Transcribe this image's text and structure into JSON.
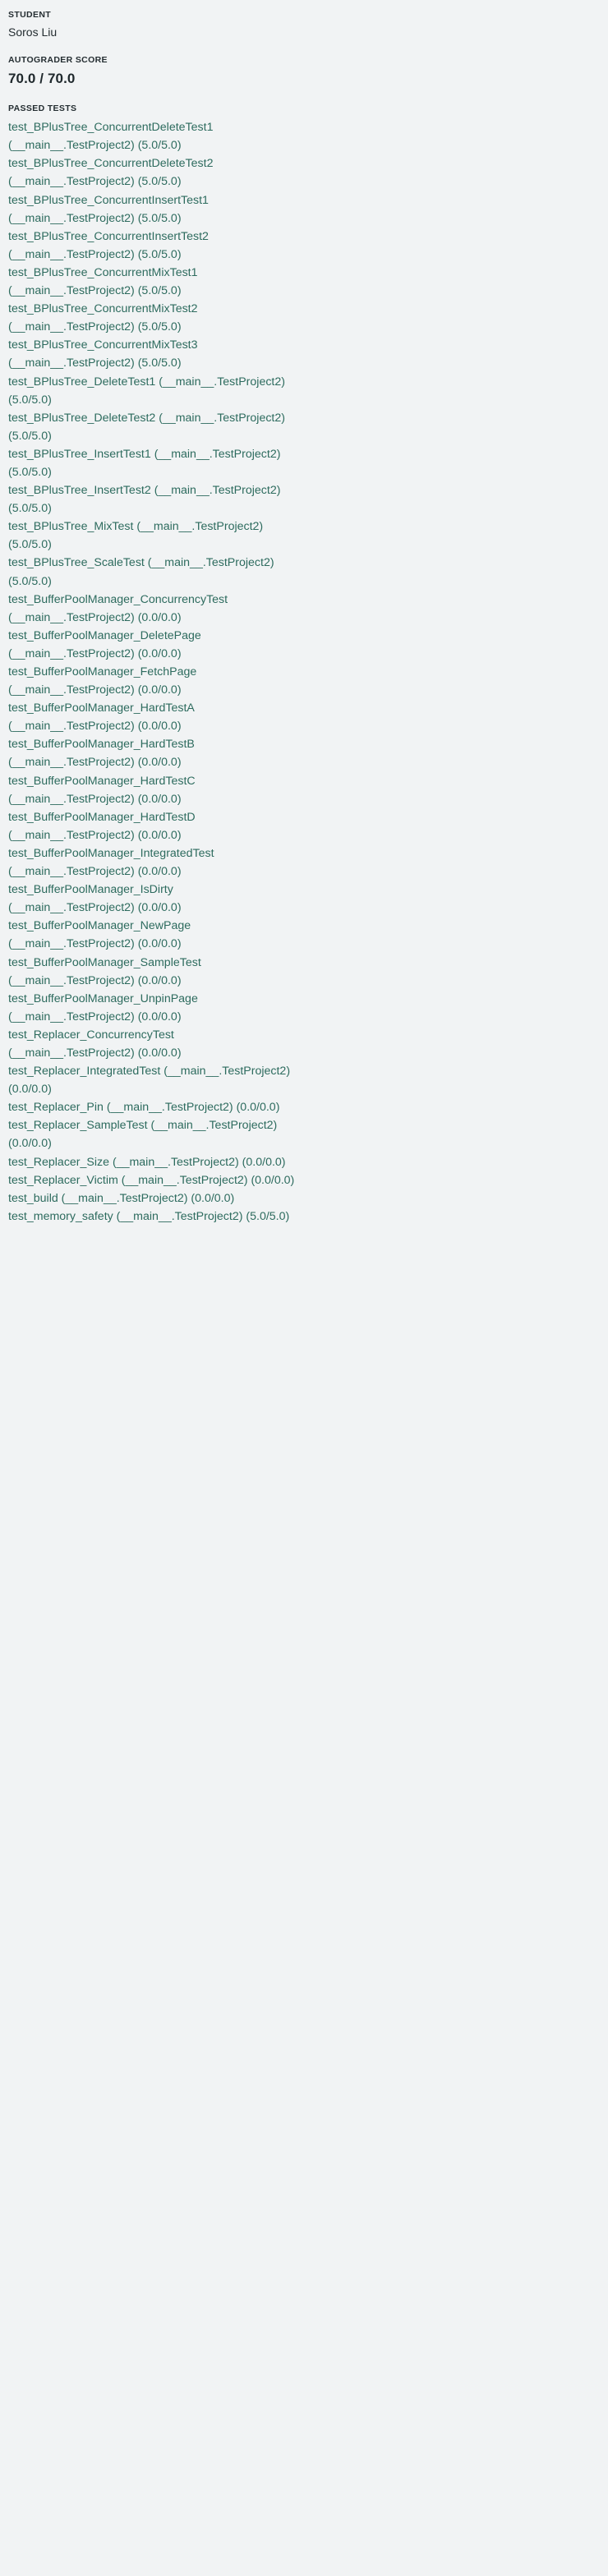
{
  "student": {
    "label": "STUDENT",
    "name": "Soros Liu"
  },
  "autograder": {
    "label": "AUTOGRADER SCORE",
    "score": "70.0 / 70.0"
  },
  "passed_tests": {
    "label": "PASSED TESTS",
    "items": [
      "test_BPlusTree_ConcurrentDeleteTest1 (__main__.TestProject2) (5.0/5.0)",
      "test_BPlusTree_ConcurrentDeleteTest2 (__main__.TestProject2) (5.0/5.0)",
      "test_BPlusTree_ConcurrentInsertTest1 (__main__.TestProject2) (5.0/5.0)",
      "test_BPlusTree_ConcurrentInsertTest2 (__main__.TestProject2) (5.0/5.0)",
      "test_BPlusTree_ConcurrentMixTest1 (__main__.TestProject2) (5.0/5.0)",
      "test_BPlusTree_ConcurrentMixTest2 (__main__.TestProject2) (5.0/5.0)",
      "test_BPlusTree_ConcurrentMixTest3 (__main__.TestProject2) (5.0/5.0)",
      "test_BPlusTree_DeleteTest1 (__main__.TestProject2) (5.0/5.0)",
      "test_BPlusTree_DeleteTest2 (__main__.TestProject2) (5.0/5.0)",
      "test_BPlusTree_InsertTest1 (__main__.TestProject2) (5.0/5.0)",
      "test_BPlusTree_InsertTest2 (__main__.TestProject2) (5.0/5.0)",
      "test_BPlusTree_MixTest (__main__.TestProject2) (5.0/5.0)",
      "test_BPlusTree_ScaleTest (__main__.TestProject2) (5.0/5.0)",
      "test_BufferPoolManager_ConcurrencyTest (__main__.TestProject2) (0.0/0.0)",
      "test_BufferPoolManager_DeletePage (__main__.TestProject2) (0.0/0.0)",
      "test_BufferPoolManager_FetchPage (__main__.TestProject2) (0.0/0.0)",
      "test_BufferPoolManager_HardTestA (__main__.TestProject2) (0.0/0.0)",
      "test_BufferPoolManager_HardTestB (__main__.TestProject2) (0.0/0.0)",
      "test_BufferPoolManager_HardTestC (__main__.TestProject2) (0.0/0.0)",
      "test_BufferPoolManager_HardTestD (__main__.TestProject2) (0.0/0.0)",
      "test_BufferPoolManager_IntegratedTest (__main__.TestProject2) (0.0/0.0)",
      "test_BufferPoolManager_IsDirty (__main__.TestProject2) (0.0/0.0)",
      "test_BufferPoolManager_NewPage (__main__.TestProject2) (0.0/0.0)",
      "test_BufferPoolManager_SampleTest (__main__.TestProject2) (0.0/0.0)",
      "test_BufferPoolManager_UnpinPage (__main__.TestProject2) (0.0/0.0)",
      "test_Replacer_ConcurrencyTest (__main__.TestProject2) (0.0/0.0)",
      "test_Replacer_IntegratedTest (__main__.TestProject2) (0.0/0.0)",
      "test_Replacer_Pin (__main__.TestProject2) (0.0/0.0)",
      "test_Replacer_SampleTest (__main__.TestProject2) (0.0/0.0)",
      "test_Replacer_Size (__main__.TestProject2) (0.0/0.0)",
      "test_Replacer_Victim (__main__.TestProject2) (0.0/0.0)",
      "test_build (__main__.TestProject2) (0.0/0.0)",
      "test_memory_safety (__main__.TestProject2) (5.0/5.0)"
    ]
  },
  "colors": {
    "background": "#f1f3f4",
    "label_text": "#242d31",
    "test_text": "#2d6b5e"
  }
}
